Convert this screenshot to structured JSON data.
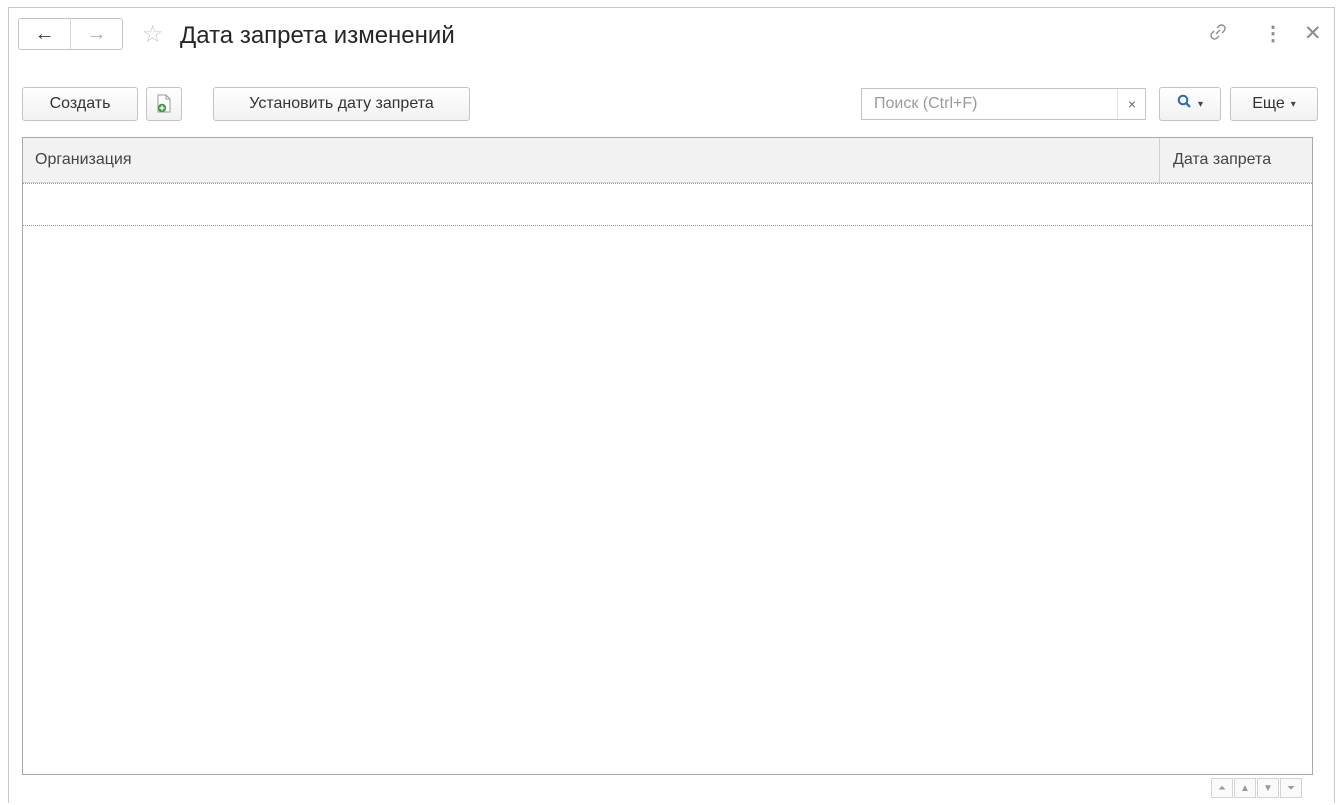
{
  "titlebar": {
    "back_glyph": "←",
    "forward_glyph": "→",
    "favorite_glyph": "☆",
    "title": "Дата запрета изменений",
    "link_glyph": "🔗",
    "more_glyph": "⋮",
    "close_glyph": "✕"
  },
  "toolbar": {
    "create_label": "Создать",
    "copy_icon": "copy-document-icon",
    "set_date_label": "Установить дату запрета",
    "search_placeholder": "Поиск (Ctrl+F)",
    "search_value": "",
    "clear_glyph": "×",
    "search_glyph": "Q",
    "more_label": "Еще",
    "caret_glyph": "▾"
  },
  "table": {
    "columns": [
      "Организация",
      "Дата запрета"
    ],
    "rows": []
  },
  "pager": {
    "first_glyph": "⏶",
    "prev_glyph": "▲",
    "next_glyph": "▼",
    "last_glyph": "⏷"
  },
  "colors": {
    "accent": "#2f66b3",
    "copy_icon_green": "#3a9b3a"
  }
}
